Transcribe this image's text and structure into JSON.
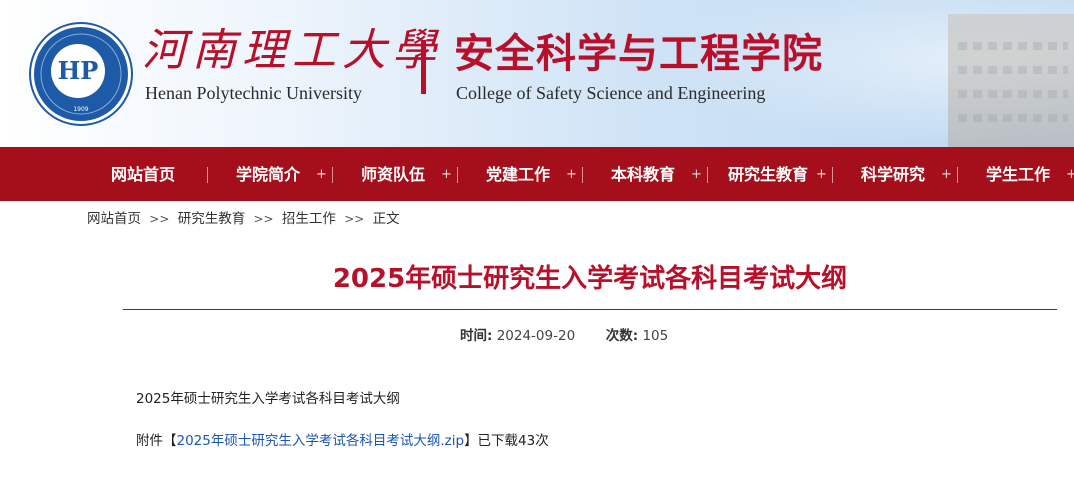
{
  "header": {
    "logo_text": "HP",
    "logo_year": "1909",
    "logo_ring_text": "HENAN POLYTECHNIC UNIVERSITY",
    "university_cn": "河南理工大學",
    "university_en": "Henan Polytechnic University",
    "college_cn": "安全科学与工程学院",
    "college_en": "College of Safety Science and Engineering"
  },
  "nav": {
    "items": [
      {
        "label": "网站首页"
      },
      {
        "label": "学院简介"
      },
      {
        "label": "师资队伍"
      },
      {
        "label": "党建工作"
      },
      {
        "label": "本科教育"
      },
      {
        "label": "研究生教育"
      },
      {
        "label": "科学研究"
      },
      {
        "label": "学生工作"
      }
    ],
    "plus": "+"
  },
  "breadcrumb": {
    "items": [
      "网站首页",
      "研究生教育",
      "招生工作",
      "正文"
    ],
    "separator": ">>"
  },
  "article": {
    "title": "2025年硕士研究生入学考试各科目考试大纲",
    "time_label": "时间:",
    "time_value": "2024-09-20",
    "views_label": "次数:",
    "views_value": "105",
    "body_line": "2025年硕士研究生入学考试各科目考试大纲",
    "attachment_prefix": "附件【",
    "attachment_name": "2025年硕士研究生入学考试各科目考试大纲.zip",
    "attachment_suffix": "】已下载43次"
  },
  "colors": {
    "brand_red": "#a50f1c",
    "title_red": "#b8102a",
    "link_blue": "#1a56b0"
  }
}
